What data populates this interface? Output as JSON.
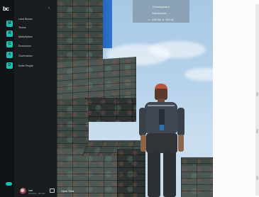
{
  "rail": {
    "logo": "bc",
    "buttons": [
      "M",
      "R",
      "C",
      "X",
      "D"
    ]
  },
  "menu": {
    "items": [
      "Land Blocks",
      "Teams",
      "Marketplace",
      "Economics",
      "Governance",
      "Invite People"
    ]
  },
  "dev_panel": {
    "line1": "Development",
    "line2": "Subdivision →",
    "line3": "x: -150.36, z: 102.42"
  },
  "location_box": {
    "line1": "Allocation",
    "line2": "x: -150.36",
    "line3": "MP",
    "line4": "50 / 10 MP"
  },
  "user": {
    "name": "mad",
    "address": "0x8.4b01...bf6.434"
  },
  "chat": {
    "label": "Open Chat"
  },
  "colors": {
    "accent": "#19c0b6",
    "rail_bg": "#111416",
    "menu_bg": "#191d20"
  }
}
